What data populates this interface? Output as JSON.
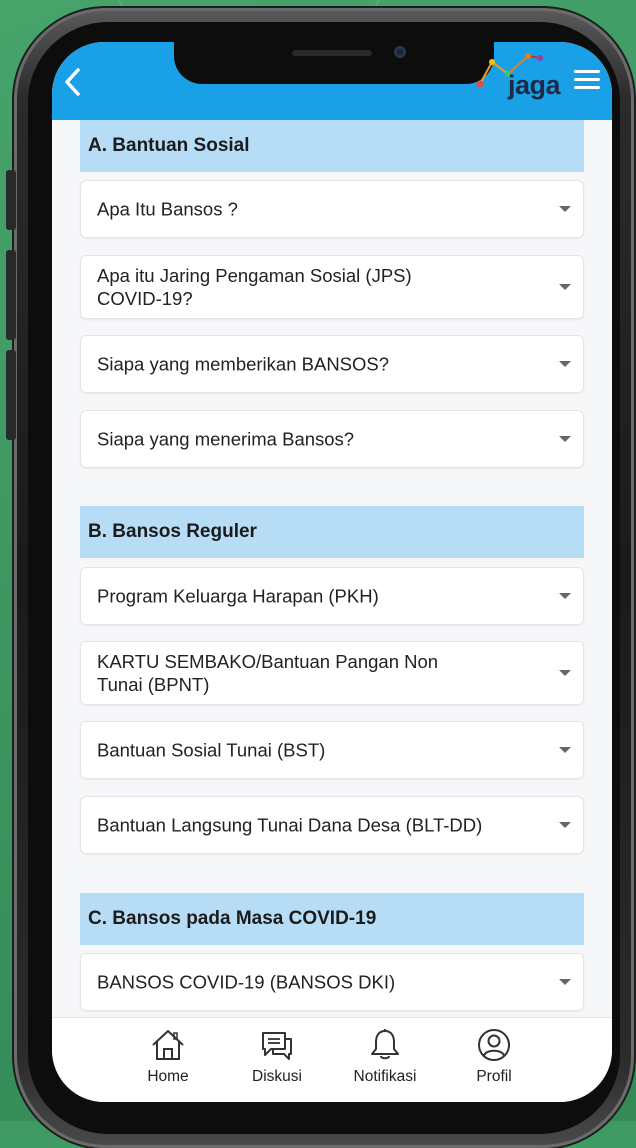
{
  "header": {
    "back_icon": "chevron-left-icon",
    "logo_text": "jaga",
    "menu_icon": "hamburger-menu-icon",
    "color": "#1aa0e6"
  },
  "sections": [
    {
      "title": "A. Bantuan Sosial",
      "items": [
        "Apa Itu Bansos ?",
        "Apa itu Jaring Pengaman Sosial (JPS) COVID-19?",
        "Siapa yang memberikan BANSOS?",
        "Siapa yang menerima Bansos?"
      ]
    },
    {
      "title": "B. Bansos Reguler",
      "items": [
        "Program Keluarga Harapan (PKH)",
        "KARTU SEMBAKO/Bantuan Pangan Non Tunai (BPNT)",
        "Bantuan Sosial Tunai (BST)",
        "Bantuan Langsung Tunai Dana Desa (BLT-DD)"
      ]
    },
    {
      "title": "C. Bansos pada Masa COVID-19",
      "items": [
        "BANSOS COVID-19 (BANSOS DKI)"
      ]
    }
  ],
  "tabbar": {
    "tabs": [
      {
        "label": "Home",
        "icon": "home-icon"
      },
      {
        "label": "Diskusi",
        "icon": "chat-icon"
      },
      {
        "label": "Notifikasi",
        "icon": "bell-icon"
      },
      {
        "label": "Profil",
        "icon": "user-icon"
      }
    ]
  }
}
